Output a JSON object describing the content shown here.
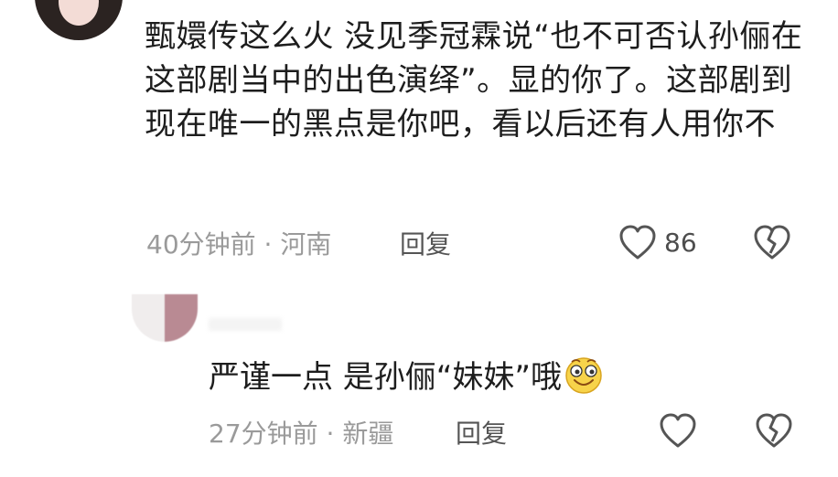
{
  "comment": {
    "text": "甄嬛传这么火 没见季冠霖说“也不可否认孙俪在这部剧当中的出色演绎”。显的你了。这部剧到现在唯一的黑点是你吧，看以后还有人用你不",
    "time": "40分钟前",
    "location": "河南",
    "reply_label": "回复",
    "likes": "86"
  },
  "reply": {
    "text": "严谨一点 是孙俪“妹妹”哦",
    "time": "27分钟前",
    "location": "新疆",
    "reply_label": "回复"
  },
  "colors": {
    "meta_gray": "#9a9a9a",
    "text_dark": "#1d1d1d",
    "icon_gray": "#555555"
  },
  "icons": [
    "avatar",
    "heart-outline-icon",
    "broken-heart-icon",
    "smiling-emoji-icon"
  ]
}
